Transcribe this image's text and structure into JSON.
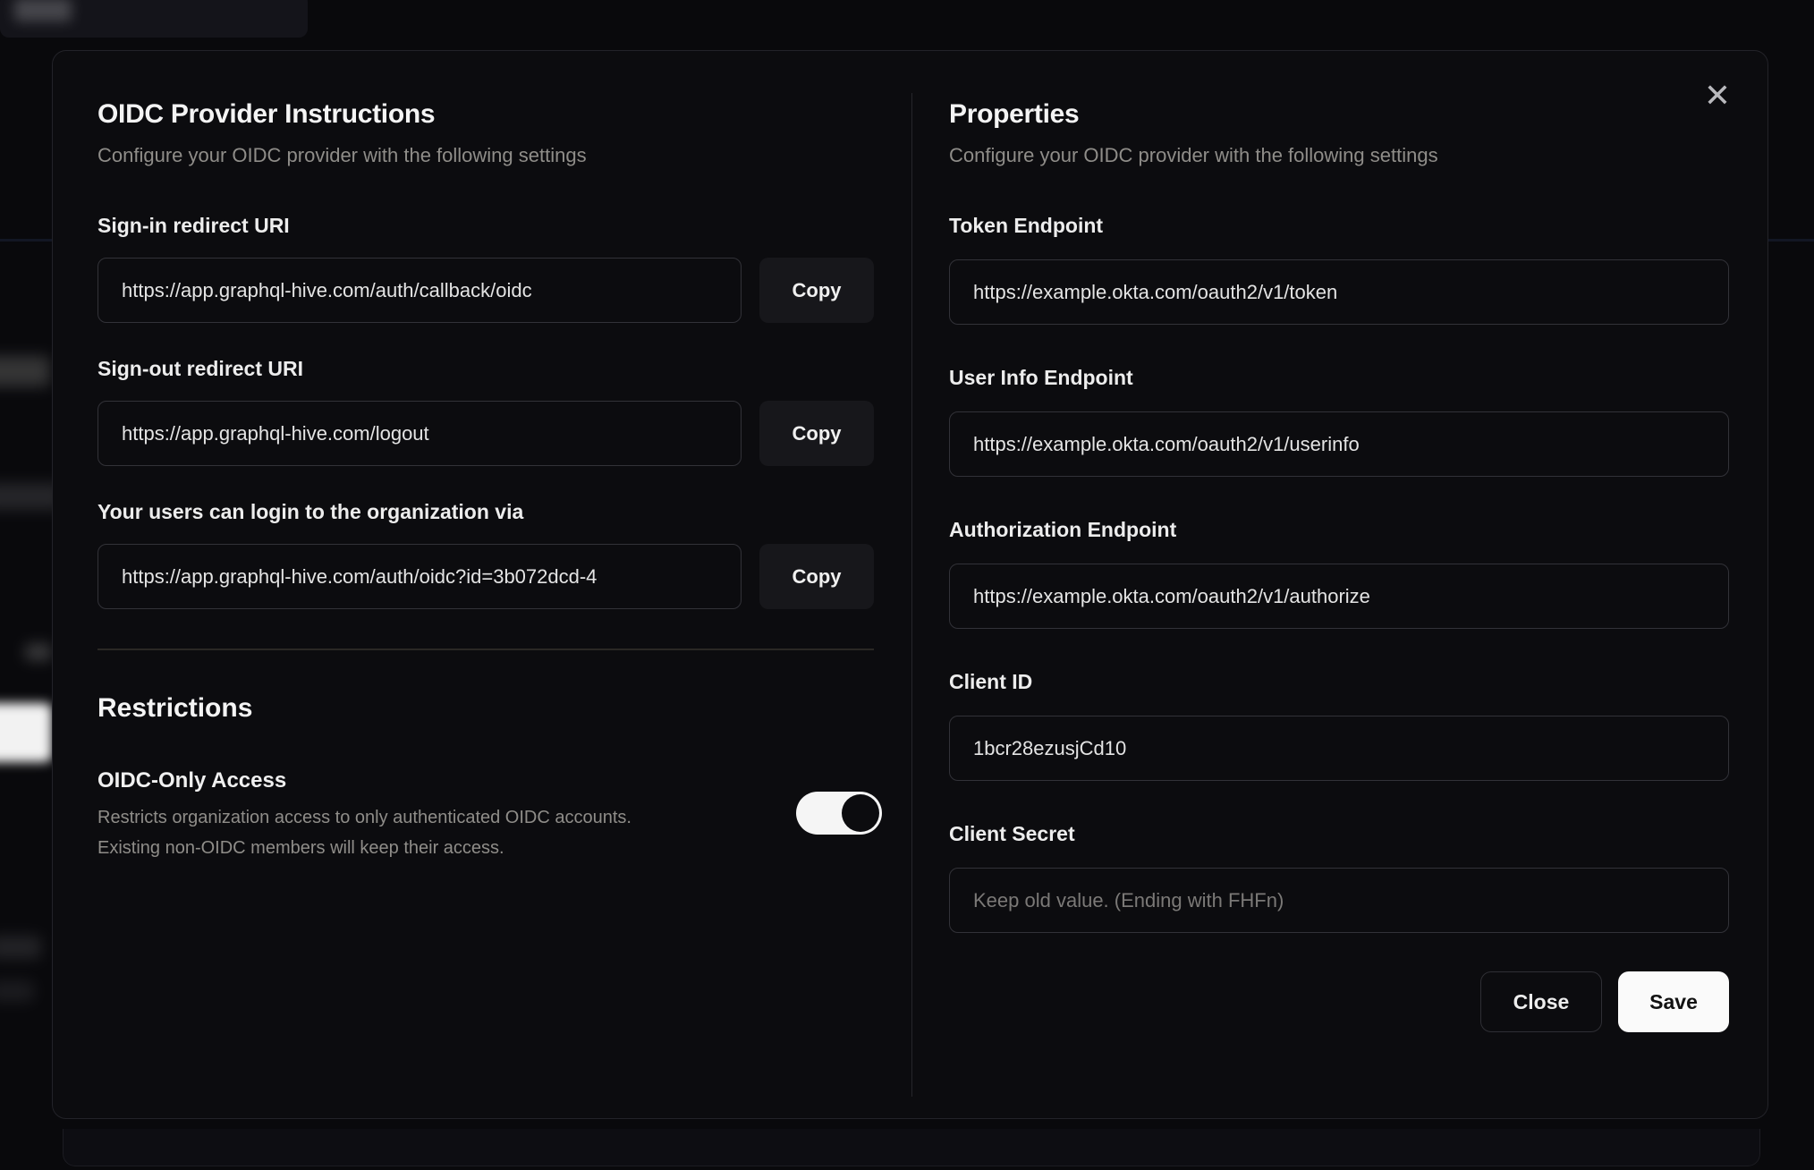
{
  "modal": {
    "close_icon": "✕",
    "left": {
      "title": "OIDC Provider Instructions",
      "subtitle": "Configure your OIDC provider with the following settings",
      "fields": [
        {
          "label": "Sign-in redirect URI",
          "value": "https://app.graphql-hive.com/auth/callback/oidc",
          "button_label": "Copy"
        },
        {
          "label": "Sign-out redirect URI",
          "value": "https://app.graphql-hive.com/logout",
          "button_label": "Copy"
        },
        {
          "label": "Your users can login to the organization via",
          "value": "https://app.graphql-hive.com/auth/oidc?id=3b072dcd-4",
          "button_label": "Copy"
        }
      ],
      "restrictions": {
        "title": "Restrictions",
        "toggle_label": "OIDC-Only Access",
        "description_line1": "Restricts organization access to only authenticated OIDC accounts.",
        "description_line2": "Existing non-OIDC members will keep their access.",
        "toggle_state": "true"
      }
    },
    "right": {
      "title": "Properties",
      "subtitle": "Configure your OIDC provider with the following settings",
      "fields": [
        {
          "label": "Token Endpoint",
          "value": "https://example.okta.com/oauth2/v1/token"
        },
        {
          "label": "User Info Endpoint",
          "value": "https://example.okta.com/oauth2/v1/userinfo"
        },
        {
          "label": "Authorization Endpoint",
          "value": "https://example.okta.com/oauth2/v1/authorize"
        },
        {
          "label": "Client ID",
          "value": "1bcr28ezusjCd10"
        },
        {
          "label": "Client Secret",
          "placeholder": "Keep old value. (Ending with FHFn)"
        }
      ],
      "footer": {
        "close_label": "Close",
        "save_label": "Save"
      }
    },
    "colors": {
      "modal_background": "#0c0c0f",
      "save_button": "#fafafa",
      "toggle_on": "#f5f5f5",
      "muted_text": "#8f8d89"
    }
  }
}
